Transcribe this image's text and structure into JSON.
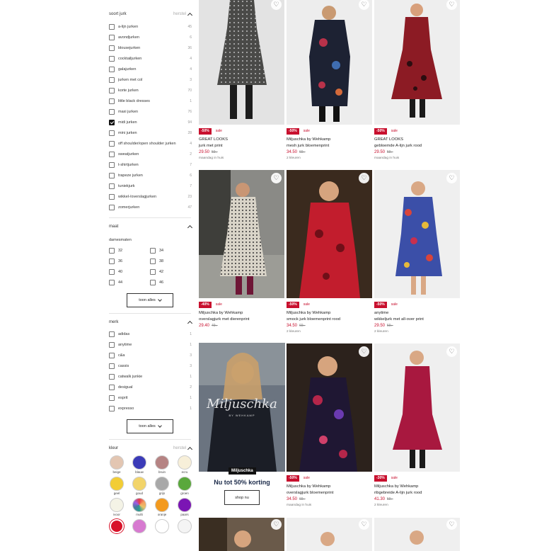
{
  "sidebar": {
    "soort_jurk": {
      "title": "soort jurk",
      "reset": "herstel",
      "items": [
        {
          "label": "a-lijn jurken",
          "count": "45",
          "checked": false
        },
        {
          "label": "avondjurken",
          "count": "6",
          "checked": false
        },
        {
          "label": "blousejurken",
          "count": "36",
          "checked": false
        },
        {
          "label": "cocktailjurken",
          "count": "4",
          "checked": false
        },
        {
          "label": "galajurken",
          "count": "4",
          "checked": false
        },
        {
          "label": "jurken met col",
          "count": "3",
          "checked": false
        },
        {
          "label": "korte jurken",
          "count": "70",
          "checked": false
        },
        {
          "label": "little black dresses",
          "count": "1",
          "checked": false
        },
        {
          "label": "maxi jurken",
          "count": "76",
          "checked": false
        },
        {
          "label": "midi jurken",
          "count": "94",
          "checked": true
        },
        {
          "label": "mini jurken",
          "count": "28",
          "checked": false
        },
        {
          "label": "off shoulder/open shoulder jurken",
          "count": "4",
          "checked": false
        },
        {
          "label": "sweatjurken",
          "count": "2",
          "checked": false
        },
        {
          "label": "t-shirtjurken",
          "count": "7",
          "checked": false
        },
        {
          "label": "trapeze jurken",
          "count": "6",
          "checked": false
        },
        {
          "label": "tuniekjurk",
          "count": "7",
          "checked": false
        },
        {
          "label": "wikkel-/overslagjurken",
          "count": "23",
          "checked": false
        },
        {
          "label": "zomerjurken",
          "count": "47",
          "checked": false
        }
      ]
    },
    "maat": {
      "title": "maat",
      "subtitle": "damesmaten",
      "sizes": [
        "32",
        "34",
        "36",
        "38",
        "40",
        "42",
        "44",
        "46"
      ],
      "show_all": "toon alles"
    },
    "merk": {
      "title": "merk",
      "items": [
        {
          "label": "adidas",
          "count": "1"
        },
        {
          "label": "anytime",
          "count": "1"
        },
        {
          "label": "c&a",
          "count": "3"
        },
        {
          "label": "cassis",
          "count": "3"
        },
        {
          "label": "catwalk junkie",
          "count": "1"
        },
        {
          "label": "desigual",
          "count": "2"
        },
        {
          "label": "esprit",
          "count": "1"
        },
        {
          "label": "expresso",
          "count": "1"
        }
      ],
      "show_all": "toon alles"
    },
    "kleur": {
      "title": "kleur",
      "reset": "herstel",
      "swatches": [
        {
          "label": "beige",
          "color": "#e3c6b2"
        },
        {
          "label": "blauw",
          "color": "#3b3bb8"
        },
        {
          "label": "bruin",
          "color": "#b58383"
        },
        {
          "label": "ecru",
          "color": "#f7efd9"
        },
        {
          "label": "geel",
          "color": "#f2cd35"
        },
        {
          "label": "goud",
          "color": "#f2d46a"
        },
        {
          "label": "grijs",
          "color": "#a8a8a8"
        },
        {
          "label": "groen",
          "color": "#5aa83c"
        },
        {
          "label": "ivoor",
          "color": "#f4f3e6"
        },
        {
          "label": "multi",
          "color": "multi"
        },
        {
          "label": "oranje",
          "color": "#f39a1e"
        },
        {
          "label": "paars",
          "color": "#7b15b4"
        },
        {
          "label": "",
          "color": "#d8132a"
        },
        {
          "label": "",
          "color": "#d77ad0"
        },
        {
          "label": "",
          "color": "#ffffff"
        },
        {
          "label": "",
          "color": "#f4f4f4"
        }
      ]
    }
  },
  "products": [
    {
      "discount": "-50%",
      "sale": "sale",
      "brand": "GREAT LOOKS",
      "name": "jurk met print",
      "price": "29.50",
      "old_price": "59.-",
      "note": "maandag in huis"
    },
    {
      "discount": "-50%",
      "sale": "sale",
      "brand": "Miljuschka by Wehkamp",
      "name": "mesh jurk bloemenprint",
      "price": "34.50",
      "old_price": "69.-",
      "note": "2 kleuren"
    },
    {
      "discount": "-50%",
      "sale": "sale",
      "brand": "GREAT LOOKS",
      "name": "gebloemde A-lijn jurk rood",
      "price": "29.50",
      "old_price": "59.-",
      "note": "maandag in huis"
    },
    {
      "discount": "-40%",
      "sale": "sale",
      "brand": "Miljuschka by Wehkamp",
      "name": "overslagjurk met dierenprint",
      "price": "29.40",
      "old_price": "49.-",
      "note": ""
    },
    {
      "discount": "-50%",
      "sale": "sale",
      "brand": "Miljuschka by Wehkamp",
      "name": "smock jurk bloemenprint rood",
      "price": "34.50",
      "old_price": "69.-",
      "note": "2 kleuren"
    },
    {
      "discount": "-50%",
      "sale": "sale",
      "brand": "anytime",
      "name": "wikkeljurk met all-over print",
      "price": "29.50",
      "old_price": "59.-",
      "note": "2 kleuren"
    },
    {
      "discount": "-50%",
      "sale": "sale",
      "brand": "Miljuschka by Wehkamp",
      "name": "overslagjurk bloemenprint",
      "price": "34.50",
      "old_price": "69.-",
      "note": "maandag in huis"
    },
    {
      "discount": "-30%",
      "sale": "sale",
      "brand": "Miljuschka by Wehkamp",
      "name": "ribgebreide A-lijn jurk rood",
      "price": "41.30",
      "old_price": "59.-",
      "note": "2 kleuren"
    }
  ],
  "promo": {
    "logo": "Miljuschka",
    "logo_sub": "BY WEHKAMP",
    "tag": "Miljuschka",
    "title": "Nu tot 50% korting",
    "button": "shop nu"
  },
  "icons": {
    "wishlist": "heart-icon",
    "collapse": "chevron-up-icon",
    "expand": "chevron-down-icon",
    "checkbox": "checkbox-icon"
  }
}
